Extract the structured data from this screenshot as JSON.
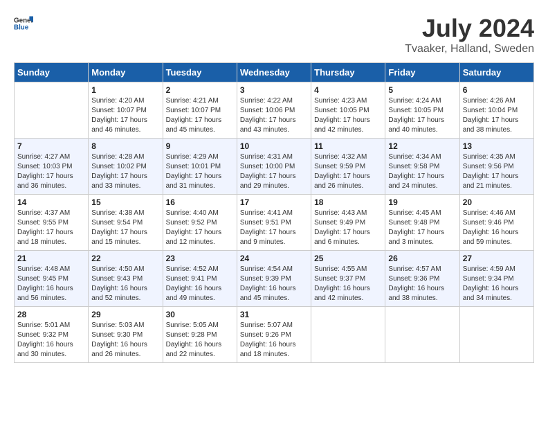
{
  "header": {
    "logo_general": "General",
    "logo_blue": "Blue",
    "title": "July 2024",
    "subtitle": "Tvaaker, Halland, Sweden"
  },
  "calendar": {
    "days_of_week": [
      "Sunday",
      "Monday",
      "Tuesday",
      "Wednesday",
      "Thursday",
      "Friday",
      "Saturday"
    ],
    "weeks": [
      [
        {
          "day": "",
          "info": ""
        },
        {
          "day": "1",
          "info": "Sunrise: 4:20 AM\nSunset: 10:07 PM\nDaylight: 17 hours\nand 46 minutes."
        },
        {
          "day": "2",
          "info": "Sunrise: 4:21 AM\nSunset: 10:07 PM\nDaylight: 17 hours\nand 45 minutes."
        },
        {
          "day": "3",
          "info": "Sunrise: 4:22 AM\nSunset: 10:06 PM\nDaylight: 17 hours\nand 43 minutes."
        },
        {
          "day": "4",
          "info": "Sunrise: 4:23 AM\nSunset: 10:05 PM\nDaylight: 17 hours\nand 42 minutes."
        },
        {
          "day": "5",
          "info": "Sunrise: 4:24 AM\nSunset: 10:05 PM\nDaylight: 17 hours\nand 40 minutes."
        },
        {
          "day": "6",
          "info": "Sunrise: 4:26 AM\nSunset: 10:04 PM\nDaylight: 17 hours\nand 38 minutes."
        }
      ],
      [
        {
          "day": "7",
          "info": "Sunrise: 4:27 AM\nSunset: 10:03 PM\nDaylight: 17 hours\nand 36 minutes."
        },
        {
          "day": "8",
          "info": "Sunrise: 4:28 AM\nSunset: 10:02 PM\nDaylight: 17 hours\nand 33 minutes."
        },
        {
          "day": "9",
          "info": "Sunrise: 4:29 AM\nSunset: 10:01 PM\nDaylight: 17 hours\nand 31 minutes."
        },
        {
          "day": "10",
          "info": "Sunrise: 4:31 AM\nSunset: 10:00 PM\nDaylight: 17 hours\nand 29 minutes."
        },
        {
          "day": "11",
          "info": "Sunrise: 4:32 AM\nSunset: 9:59 PM\nDaylight: 17 hours\nand 26 minutes."
        },
        {
          "day": "12",
          "info": "Sunrise: 4:34 AM\nSunset: 9:58 PM\nDaylight: 17 hours\nand 24 minutes."
        },
        {
          "day": "13",
          "info": "Sunrise: 4:35 AM\nSunset: 9:56 PM\nDaylight: 17 hours\nand 21 minutes."
        }
      ],
      [
        {
          "day": "14",
          "info": "Sunrise: 4:37 AM\nSunset: 9:55 PM\nDaylight: 17 hours\nand 18 minutes."
        },
        {
          "day": "15",
          "info": "Sunrise: 4:38 AM\nSunset: 9:54 PM\nDaylight: 17 hours\nand 15 minutes."
        },
        {
          "day": "16",
          "info": "Sunrise: 4:40 AM\nSunset: 9:52 PM\nDaylight: 17 hours\nand 12 minutes."
        },
        {
          "day": "17",
          "info": "Sunrise: 4:41 AM\nSunset: 9:51 PM\nDaylight: 17 hours\nand 9 minutes."
        },
        {
          "day": "18",
          "info": "Sunrise: 4:43 AM\nSunset: 9:49 PM\nDaylight: 17 hours\nand 6 minutes."
        },
        {
          "day": "19",
          "info": "Sunrise: 4:45 AM\nSunset: 9:48 PM\nDaylight: 17 hours\nand 3 minutes."
        },
        {
          "day": "20",
          "info": "Sunrise: 4:46 AM\nSunset: 9:46 PM\nDaylight: 16 hours\nand 59 minutes."
        }
      ],
      [
        {
          "day": "21",
          "info": "Sunrise: 4:48 AM\nSunset: 9:45 PM\nDaylight: 16 hours\nand 56 minutes."
        },
        {
          "day": "22",
          "info": "Sunrise: 4:50 AM\nSunset: 9:43 PM\nDaylight: 16 hours\nand 52 minutes."
        },
        {
          "day": "23",
          "info": "Sunrise: 4:52 AM\nSunset: 9:41 PM\nDaylight: 16 hours\nand 49 minutes."
        },
        {
          "day": "24",
          "info": "Sunrise: 4:54 AM\nSunset: 9:39 PM\nDaylight: 16 hours\nand 45 minutes."
        },
        {
          "day": "25",
          "info": "Sunrise: 4:55 AM\nSunset: 9:37 PM\nDaylight: 16 hours\nand 42 minutes."
        },
        {
          "day": "26",
          "info": "Sunrise: 4:57 AM\nSunset: 9:36 PM\nDaylight: 16 hours\nand 38 minutes."
        },
        {
          "day": "27",
          "info": "Sunrise: 4:59 AM\nSunset: 9:34 PM\nDaylight: 16 hours\nand 34 minutes."
        }
      ],
      [
        {
          "day": "28",
          "info": "Sunrise: 5:01 AM\nSunset: 9:32 PM\nDaylight: 16 hours\nand 30 minutes."
        },
        {
          "day": "29",
          "info": "Sunrise: 5:03 AM\nSunset: 9:30 PM\nDaylight: 16 hours\nand 26 minutes."
        },
        {
          "day": "30",
          "info": "Sunrise: 5:05 AM\nSunset: 9:28 PM\nDaylight: 16 hours\nand 22 minutes."
        },
        {
          "day": "31",
          "info": "Sunrise: 5:07 AM\nSunset: 9:26 PM\nDaylight: 16 hours\nand 18 minutes."
        },
        {
          "day": "",
          "info": ""
        },
        {
          "day": "",
          "info": ""
        },
        {
          "day": "",
          "info": ""
        }
      ]
    ]
  }
}
